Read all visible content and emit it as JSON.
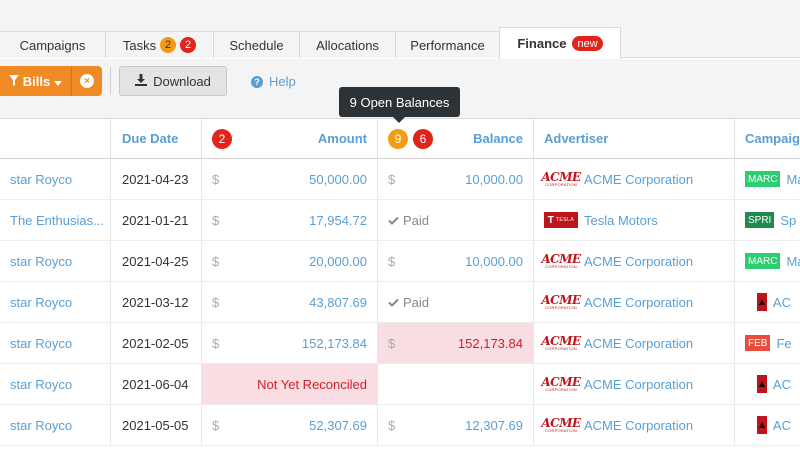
{
  "tabs": [
    {
      "label": "Campaigns"
    },
    {
      "label": "Tasks",
      "badges": [
        "2",
        "2"
      ]
    },
    {
      "label": "Schedule"
    },
    {
      "label": "Allocations"
    },
    {
      "label": "Performance"
    },
    {
      "label": "Finance",
      "badge": "new",
      "active": true
    }
  ],
  "toolbar": {
    "bills_label": "Bills",
    "clear_icon_glyph": "×",
    "download_label": "Download",
    "help_label": "Help"
  },
  "tooltip": "9 Open Balances",
  "columns": {
    "due_date": "Due Date",
    "amount": "Amount",
    "amount_count": "2",
    "balance": "Balance",
    "balance_open_count": "9",
    "balance_red_count": "6",
    "advertiser": "Advertiser",
    "campaign": "Campaig"
  },
  "currency_symbol": "$",
  "rows": [
    {
      "name": "star Royco",
      "due": "2021-04-23",
      "amount": "50,000.00",
      "balance": "10,000.00",
      "balance_state": "open",
      "advertiser": "ACME Corporation",
      "advertiser_logo": "acme",
      "campaign_tag": "MARC",
      "campaign_tag_color": "#2ecc71",
      "campaign_text": "Ma"
    },
    {
      "name": "The Enthusias...",
      "due": "2021-01-21",
      "amount": "17,954.72",
      "balance": "Paid",
      "balance_state": "paid",
      "advertiser": "Tesla Motors",
      "advertiser_logo": "tesla",
      "campaign_tag": "SPRI",
      "campaign_tag_color": "#1e8a4c",
      "campaign_text": "Sp"
    },
    {
      "name": "star Royco",
      "due": "2021-04-25",
      "amount": "20,000.00",
      "balance": "10,000.00",
      "balance_state": "open",
      "advertiser": "ACME Corporation",
      "advertiser_logo": "acme",
      "campaign_tag": "MARC",
      "campaign_tag_color": "#2ecc71",
      "campaign_text": "Ma"
    },
    {
      "name": "star Royco",
      "due": "2021-03-12",
      "amount": "43,807.69",
      "balance": "Paid",
      "balance_state": "paid",
      "advertiser": "ACME Corporation",
      "advertiser_logo": "acme",
      "campaign_tag": "",
      "campaign_text": "AC"
    },
    {
      "name": "star Royco",
      "due": "2021-02-05",
      "amount": "152,173.84",
      "balance": "152,173.84",
      "balance_state": "overdue",
      "advertiser": "ACME Corporation",
      "advertiser_logo": "acme",
      "campaign_tag": "FEB",
      "campaign_tag_color": "#e74c3c",
      "campaign_text": "Fe"
    },
    {
      "name": "star Royco",
      "due": "2021-06-04",
      "amount": "Not Yet Reconciled",
      "amount_state": "unreconciled",
      "balance": "",
      "balance_state": "empty",
      "advertiser": "ACME Corporation",
      "advertiser_logo": "acme",
      "campaign_tag": "",
      "campaign_text": "AC"
    },
    {
      "name": "star Royco",
      "due": "2021-05-05",
      "amount": "52,307.69",
      "balance": "12,307.69",
      "balance_state": "open",
      "advertiser": "ACME Corporation",
      "advertiser_logo": "acme",
      "campaign_tag": "",
      "campaign_text": "AC"
    }
  ],
  "logos": {
    "acme_top": "ACME",
    "acme_bottom": "CORPORATION",
    "tesla_mark": "T",
    "tesla_word": "TESLA"
  },
  "colors": {
    "accent": "#5a9fd4",
    "orange": "#f08a24",
    "red": "#e2231a",
    "pink_bg": "#f8dde2"
  }
}
